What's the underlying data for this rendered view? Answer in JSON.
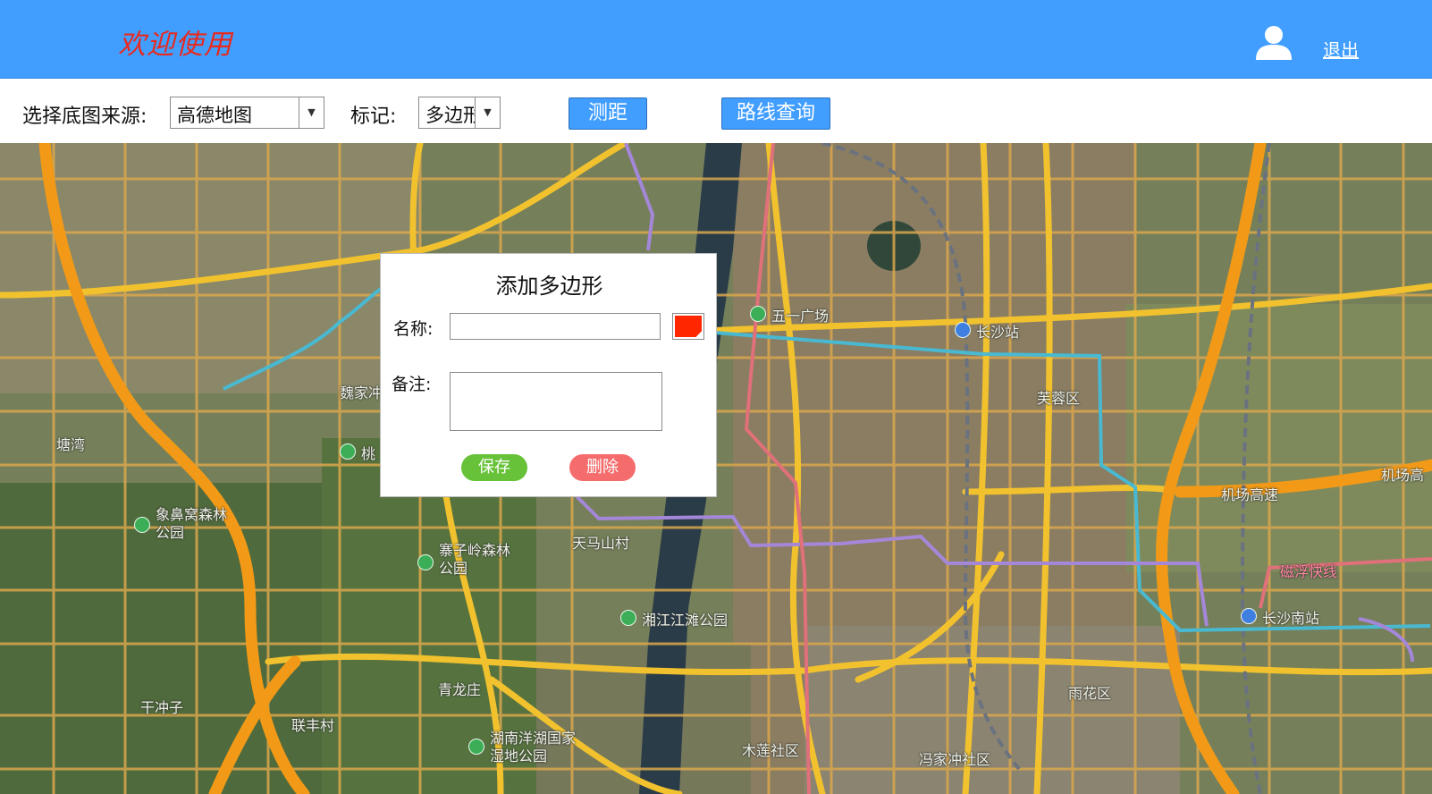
{
  "header": {
    "welcome": "欢迎使用",
    "logout": "退出",
    "user_icon": "user-icon",
    "background_color": "#419eff",
    "welcome_color": "#e8291e"
  },
  "toolbar": {
    "basemap_label": "选择底图来源:",
    "basemap_selected": "高德地图",
    "marker_label": "标记:",
    "marker_selected": "多边形",
    "measure_button": "测距",
    "route_button": "路线查询"
  },
  "map": {
    "labels": [
      "五一广场",
      "长沙站",
      "芙蓉区",
      "机场高速",
      "机场高",
      "磁浮快线",
      "长沙南站",
      "雨花区",
      "木莲社区",
      "冯家冲社区",
      "湘江江滩公园",
      "天马山村",
      "寨子岭森林公园",
      "青龙庄",
      "湖南洋湖国家湿地公园",
      "联丰村",
      "干冲子",
      "象鼻窝森林公园",
      "塘湾",
      "魏家冲",
      "桃"
    ]
  },
  "dialog": {
    "title": "添加多边形",
    "name_label": "名称:",
    "name_value": "",
    "color": "#ff2600",
    "remark_label": "备注:",
    "remark_value": "",
    "save_button": "保存",
    "delete_button": "删除",
    "save_color": "#67c23a",
    "delete_color": "#f56c6c"
  }
}
